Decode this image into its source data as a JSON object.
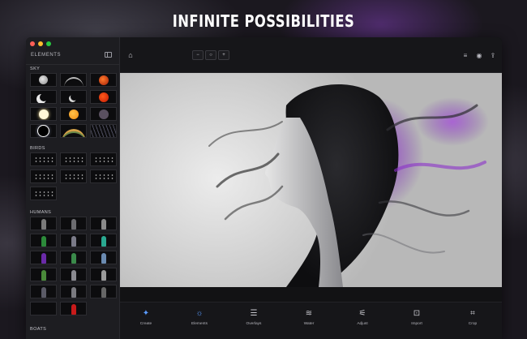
{
  "headline": "INFINITE POSSIBILITIES",
  "sidebar": {
    "title": "ELEMENTS",
    "sections": [
      {
        "label": "SKY"
      },
      {
        "label": "BIRDS"
      },
      {
        "label": "HUMANS"
      },
      {
        "label": "BOATS"
      }
    ]
  },
  "toolbar": {
    "zoom_out": "−",
    "zoom_fit": "○",
    "zoom_in": "+"
  },
  "tools": [
    {
      "label": "Create"
    },
    {
      "label": "Elements"
    },
    {
      "label": "Overlays"
    },
    {
      "label": "Water"
    },
    {
      "label": "Adjust"
    },
    {
      "label": "Import"
    },
    {
      "label": "Crop"
    }
  ],
  "colors": {
    "accent": "#5a9bff",
    "smoke_purple": "#8a2fc9",
    "window_bg": "#161619"
  }
}
